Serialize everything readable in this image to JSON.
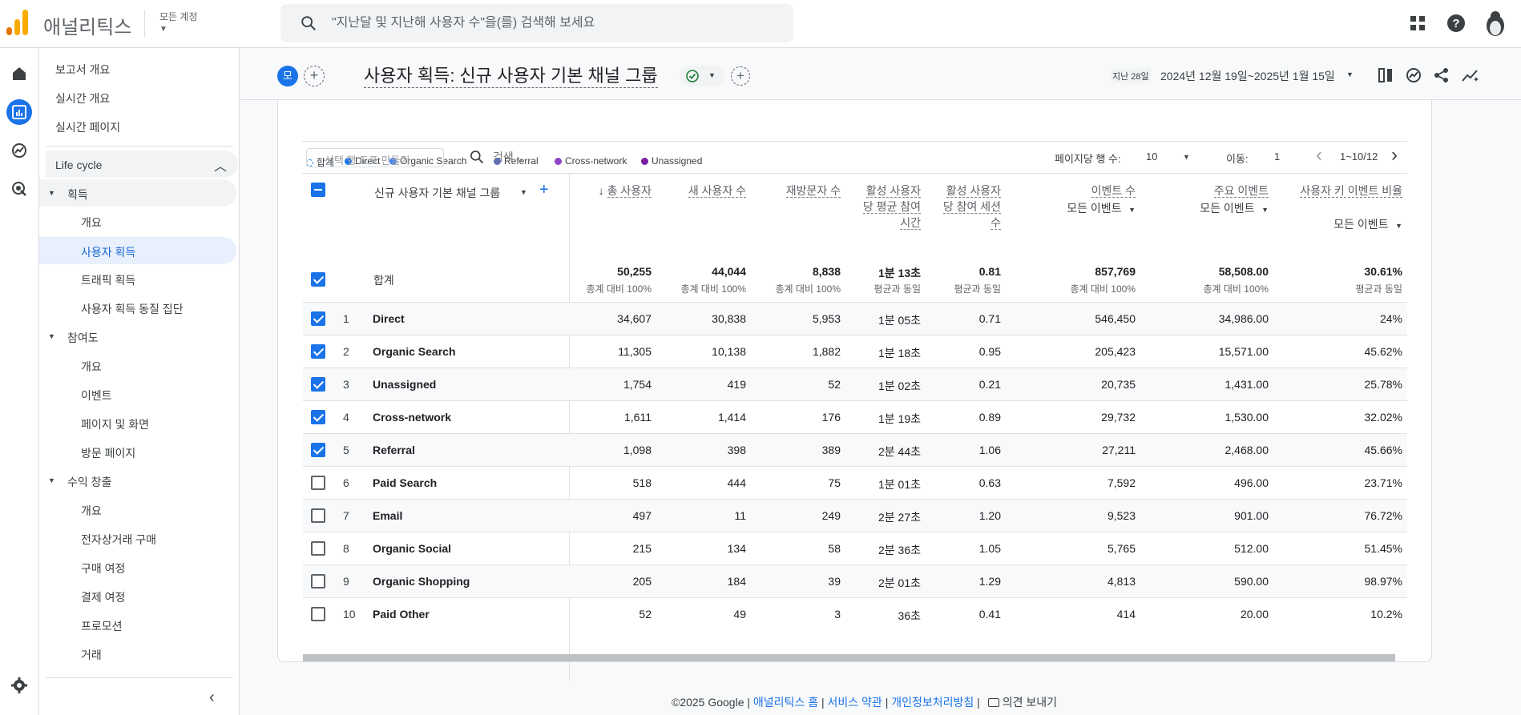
{
  "app": {
    "name": "애널리틱스",
    "account_label": "모든 계정"
  },
  "search": {
    "placeholder": "\"지난달 및 지난해 사용자 수\"을(를) 검색해 보세요"
  },
  "nav": {
    "items": [
      {
        "label": "보고서 개요"
      },
      {
        "label": "실시간 개요"
      },
      {
        "label": "실시간 페이지"
      }
    ],
    "section": "Life cycle",
    "groups": [
      {
        "label": "획득",
        "children": [
          "개요",
          "사용자 획득",
          "트래픽 획득",
          "사용자 획득 동질 집단"
        ]
      },
      {
        "label": "참여도",
        "children": [
          "개요",
          "이벤트",
          "페이지 및 화면",
          "방문 페이지"
        ]
      },
      {
        "label": "수익 창출",
        "children": [
          "개요",
          "전자상거래 구매",
          "구매 여정",
          "결제 여정",
          "프로모션",
          "거래"
        ]
      }
    ]
  },
  "header": {
    "avatar_letter": "모",
    "title": "사용자 획득: 신규 사용자 기본 채널 그룹",
    "date_prefix": "지난 28일",
    "date_range": "2024년 12월 19일~2025년 1월 15일"
  },
  "legend": [
    {
      "label": "합계",
      "color": "#1a73e8"
    },
    {
      "label": "Direct",
      "color": "#1a73e8"
    },
    {
      "label": "Organic Search",
      "color": "#4285f4"
    },
    {
      "label": "Referral",
      "color": "#5c6bc0"
    },
    {
      "label": "Cross-network",
      "color": "#8e44c6"
    },
    {
      "label": "Unassigned",
      "color": "#7b1fa2"
    }
  ],
  "toolbar": {
    "plot_placeholder": "선택 행 도표 만들기",
    "search_placeholder": "검색...",
    "rows_per_page_label": "페이지당 행 수:",
    "rows_per_page": "10",
    "goto_label": "이동:",
    "goto_value": "1",
    "page_range": "1~10/12"
  },
  "table": {
    "dimension_header": "신규 사용자 기본 채널 그룹",
    "columns": [
      {
        "label": "총 사용자",
        "sorted": true
      },
      {
        "label": "새 사용자 수"
      },
      {
        "label": "재방문자 수"
      },
      {
        "label": "활성 사용자당 평균 참여 시간"
      },
      {
        "label": "활성 사용자당 참여 세션수"
      },
      {
        "label": "이벤트 수",
        "sub": "모든 이벤트"
      },
      {
        "label": "주요 이벤트",
        "sub": "모든 이벤트"
      },
      {
        "label": "사용자 키 이벤트 비율",
        "sub": "모든 이벤트"
      }
    ],
    "totals_label": "합계",
    "totals": [
      "50,255",
      "44,044",
      "8,838",
      "1분 13초",
      "0.81",
      "857,769",
      "58,508.00",
      "30.61%"
    ],
    "totals_sub": [
      "총계 대비 100%",
      "총계 대비 100%",
      "총계 대비 100%",
      "평균과 동일",
      "평균과 동일",
      "총계 대비 100%",
      "총계 대비 100%",
      "평균과 동일"
    ],
    "rows": [
      {
        "idx": "1",
        "name": "Direct",
        "checked": true,
        "vals": [
          "34,607",
          "30,838",
          "5,953",
          "1분 05초",
          "0.71",
          "546,450",
          "34,986.00",
          "24%"
        ]
      },
      {
        "idx": "2",
        "name": "Organic Search",
        "checked": true,
        "vals": [
          "11,305",
          "10,138",
          "1,882",
          "1분 18초",
          "0.95",
          "205,423",
          "15,571.00",
          "45.62%"
        ]
      },
      {
        "idx": "3",
        "name": "Unassigned",
        "checked": true,
        "vals": [
          "1,754",
          "419",
          "52",
          "1분 02초",
          "0.21",
          "20,735",
          "1,431.00",
          "25.78%"
        ]
      },
      {
        "idx": "4",
        "name": "Cross-network",
        "checked": true,
        "vals": [
          "1,611",
          "1,414",
          "176",
          "1분 19초",
          "0.89",
          "29,732",
          "1,530.00",
          "32.02%"
        ]
      },
      {
        "idx": "5",
        "name": "Referral",
        "checked": true,
        "vals": [
          "1,098",
          "398",
          "389",
          "2분 44초",
          "1.06",
          "27,211",
          "2,468.00",
          "45.66%"
        ]
      },
      {
        "idx": "6",
        "name": "Paid Search",
        "checked": false,
        "vals": [
          "518",
          "444",
          "75",
          "1분 01초",
          "0.63",
          "7,592",
          "496.00",
          "23.71%"
        ]
      },
      {
        "idx": "7",
        "name": "Email",
        "checked": false,
        "vals": [
          "497",
          "11",
          "249",
          "2분 27초",
          "1.20",
          "9,523",
          "901.00",
          "76.72%"
        ]
      },
      {
        "idx": "8",
        "name": "Organic Social",
        "checked": false,
        "vals": [
          "215",
          "134",
          "58",
          "2분 36초",
          "1.05",
          "5,765",
          "512.00",
          "51.45%"
        ]
      },
      {
        "idx": "9",
        "name": "Organic Shopping",
        "checked": false,
        "vals": [
          "205",
          "184",
          "39",
          "2분 01초",
          "1.29",
          "4,813",
          "590.00",
          "98.97%"
        ]
      },
      {
        "idx": "10",
        "name": "Paid Other",
        "checked": false,
        "vals": [
          "52",
          "49",
          "3",
          "36초",
          "0.41",
          "414",
          "20.00",
          "10.2%"
        ]
      }
    ]
  },
  "footer": {
    "copyright": "©2025 Google |",
    "links": [
      "애널리틱스 홈",
      "서비스 약관",
      "개인정보처리방침"
    ],
    "feedback": "의견 보내기"
  }
}
